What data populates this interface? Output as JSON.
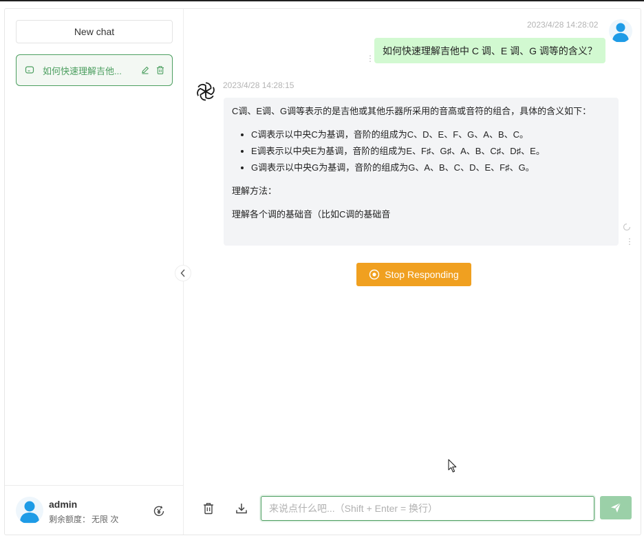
{
  "sidebar": {
    "new_chat_label": "New chat",
    "history": [
      {
        "title": "如何快速理解吉他..."
      }
    ],
    "user": {
      "name": "admin",
      "quota_label": "剩余额度：",
      "quota_value": "无限 次"
    }
  },
  "chat": {
    "messages": [
      {
        "role": "user",
        "time": "2023/4/28 14:28:02",
        "text": "如何快速理解吉他中 C 调、E 调、G 调等的含义？"
      },
      {
        "role": "assistant",
        "time": "2023/4/28 14:28:15",
        "intro": "C调、E调、G调等表示的是吉他或其他乐器所采用的音高或音符的组合，具体的含义如下：",
        "bullets": [
          "C调表示以中央C为基调，音阶的组成为C、D、E、F、G、A、B、C。",
          "E调表示以中央E为基调，音阶的组成为E、F♯、G♯、A、B、C♯、D♯、E。",
          "G调表示以中央G为基调，音阶的组成为G、A、B、C、D、E、F♯、G。"
        ],
        "para2": "理解方法：",
        "para3": "理解各个调的基础音（比如C调的基础音"
      }
    ],
    "stop_label": "Stop Responding"
  },
  "input": {
    "placeholder": "来说点什么吧...（Shift + Enter = 换行）",
    "value": ""
  },
  "icons": {
    "message": "message-square-icon",
    "edit": "pencil-icon",
    "delete": "trash-icon",
    "settings": "currency-swap-icon",
    "collapse": "chevron-left-icon",
    "stop": "stop-circle-icon",
    "download": "download-icon",
    "send": "send-icon"
  },
  "colors": {
    "accent": "#4b9e5f",
    "user_bubble": "#d2f9d1",
    "bot_bubble": "#f3f4f6",
    "stop_button": "#f0a020",
    "send_button": "#9bd0a8"
  }
}
